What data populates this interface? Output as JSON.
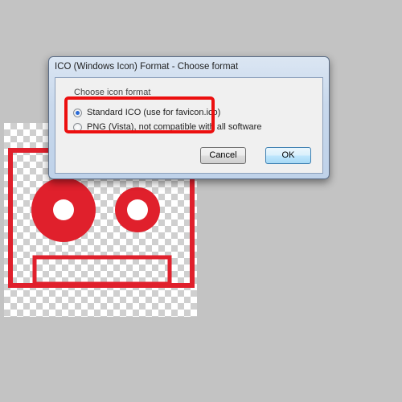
{
  "dialog": {
    "title": "ICO (Windows Icon) Format - Choose format",
    "group_label": "Choose icon format",
    "options": [
      {
        "label": "Standard ICO (use for favicon.ico)",
        "selected": true
      },
      {
        "label": "PNG (Vista), not compatible with all software",
        "selected": false
      }
    ],
    "buttons": {
      "cancel": "Cancel",
      "ok": "OK"
    }
  },
  "colors": {
    "icon_red": "#e0202c",
    "annotation_red": "#ec0f0f",
    "background_gray": "#c3c3c3"
  }
}
